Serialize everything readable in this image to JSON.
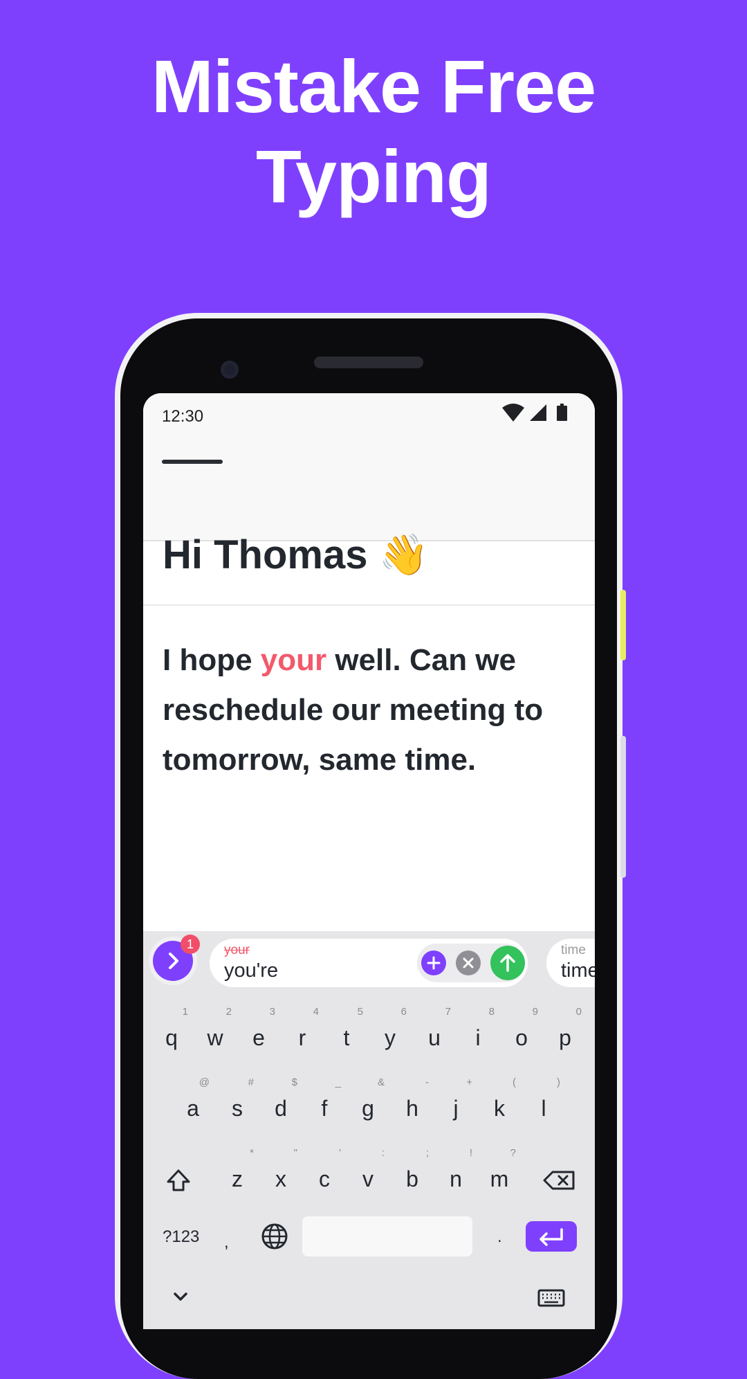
{
  "headline": {
    "line1": "Mistake Free",
    "line2": "Typing"
  },
  "status": {
    "time": "12:30"
  },
  "email": {
    "greeting": "Hi Thomas",
    "greeting_emoji": "👋",
    "body_before": "I hope ",
    "body_error_word": "your",
    "body_after": " well. Can we reschedule our meeting to tomorrow, same time."
  },
  "suggestions": {
    "badge_count": "1",
    "original": "your",
    "replacement": "you're",
    "next_original": "time",
    "next_replacement": "time"
  },
  "keyboard": {
    "rows": [
      [
        {
          "k": "q",
          "h": "1"
        },
        {
          "k": "w",
          "h": "2"
        },
        {
          "k": "e",
          "h": "3"
        },
        {
          "k": "r",
          "h": "4"
        },
        {
          "k": "t",
          "h": "5"
        },
        {
          "k": "y",
          "h": "6"
        },
        {
          "k": "u",
          "h": "7"
        },
        {
          "k": "i",
          "h": "8"
        },
        {
          "k": "o",
          "h": "9"
        },
        {
          "k": "p",
          "h": "0"
        }
      ],
      [
        {
          "k": "a",
          "h": "@"
        },
        {
          "k": "s",
          "h": "#"
        },
        {
          "k": "d",
          "h": "$"
        },
        {
          "k": "f",
          "h": "_"
        },
        {
          "k": "g",
          "h": "&"
        },
        {
          "k": "h",
          "h": "-"
        },
        {
          "k": "j",
          "h": "+"
        },
        {
          "k": "k",
          "h": "("
        },
        {
          "k": "l",
          "h": ")"
        }
      ],
      [
        {
          "k": "z",
          "h": "*"
        },
        {
          "k": "x",
          "h": "\""
        },
        {
          "k": "c",
          "h": "'"
        },
        {
          "k": "v",
          "h": ":"
        },
        {
          "k": "b",
          "h": ";"
        },
        {
          "k": "n",
          "h": "!"
        },
        {
          "k": "m",
          "h": "?"
        }
      ]
    ],
    "symbols_label": "?123",
    "comma": ",",
    "period": "."
  },
  "colors": {
    "brand": "#7f40fe",
    "error": "#f3596b",
    "accept": "#33c25c"
  },
  "icons": [
    "wifi-icon",
    "signal-icon",
    "battery-icon",
    "chevron-right-icon",
    "plus-icon",
    "close-icon",
    "arrow-up-icon",
    "shift-icon",
    "backspace-icon",
    "globe-icon",
    "enter-icon",
    "chevron-down-icon",
    "keyboard-icon"
  ]
}
